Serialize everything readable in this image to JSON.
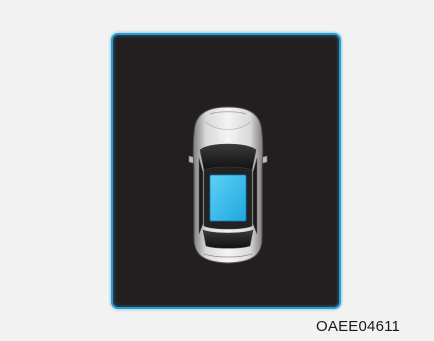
{
  "figure": {
    "code": "OAEE04611"
  },
  "display": {
    "icon": "car-top-view-icon",
    "highlight": "sunroof",
    "colors": {
      "panel_background": "#231f20",
      "panel_border": "#2a9bd0",
      "sunroof": "#2ab8ec",
      "car_body": "#c9c9c9",
      "page_background": "#f2f2f2"
    }
  }
}
